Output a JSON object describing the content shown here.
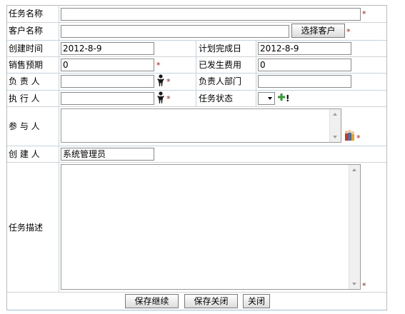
{
  "form": {
    "task_name": {
      "label": "任务名称",
      "value": ""
    },
    "customer_name": {
      "label": "客户名称",
      "value": "",
      "button": "选择客户"
    },
    "create_time": {
      "label": "创建时间",
      "value": "2012-8-9"
    },
    "planned_finish": {
      "label": "计划完成日",
      "value": "2012-8-9"
    },
    "sales_forecast": {
      "label": "销售预期",
      "value": "0"
    },
    "expense": {
      "label": "已发生费用",
      "value": "0"
    },
    "owner": {
      "label": "负 责 人",
      "value": ""
    },
    "owner_dept": {
      "label": "负责人部门",
      "value": ""
    },
    "executor": {
      "label": "执 行 人",
      "value": ""
    },
    "task_status": {
      "label": "任务状态",
      "value": "",
      "add_symbol": "+",
      "alert_symbol": "!"
    },
    "participants": {
      "label": "参 与 人",
      "value": ""
    },
    "creator": {
      "label": "创 建 人",
      "value": "系统管理员"
    },
    "description": {
      "label": "任务描述",
      "value": ""
    }
  },
  "required_mark": "*",
  "buttons": {
    "save_continue": "保存继续",
    "save_close": "保存关闭",
    "close": "关闭"
  },
  "colors": {
    "border": "#a8bed6",
    "required": "#e00000",
    "add_icon": "#2e9e2e"
  }
}
